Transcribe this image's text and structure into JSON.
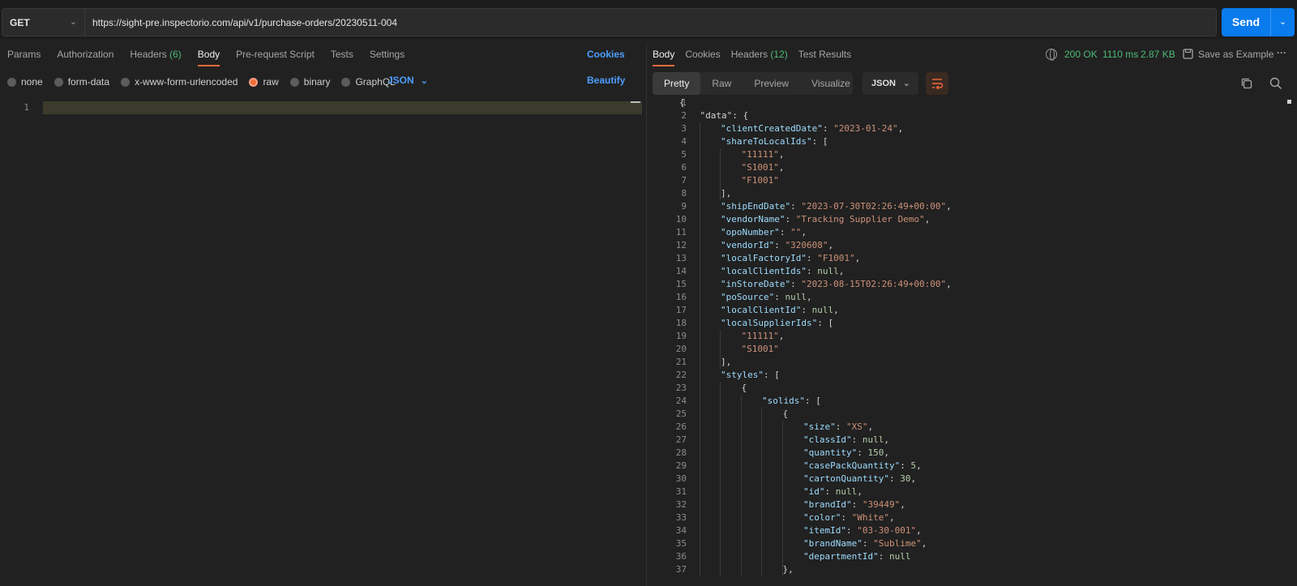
{
  "request": {
    "method": "GET",
    "url": "https://sight-pre.inspectorio.com/api/v1/purchase-orders/20230511-004",
    "send_label": "Send"
  },
  "request_tabs": [
    {
      "label": "Params"
    },
    {
      "label": "Authorization"
    },
    {
      "label": "Headers",
      "count": "(6)"
    },
    {
      "label": "Body",
      "active": true
    },
    {
      "label": "Pre-request Script"
    },
    {
      "label": "Tests"
    },
    {
      "label": "Settings"
    }
  ],
  "cookies_link": "Cookies",
  "beautify_link": "Beautify",
  "body_types": [
    {
      "label": "none"
    },
    {
      "label": "form-data"
    },
    {
      "label": "x-www-form-urlencoded"
    },
    {
      "label": "raw",
      "selected": true
    },
    {
      "label": "binary"
    },
    {
      "label": "GraphQL"
    }
  ],
  "body_format": "JSON",
  "editor": {
    "line_number": "1"
  },
  "response_tabs": [
    {
      "label": "Body",
      "active": true
    },
    {
      "label": "Cookies"
    },
    {
      "label": "Headers",
      "count": "(12)"
    },
    {
      "label": "Test Results"
    }
  ],
  "response_meta": {
    "status": "200 OK",
    "time": "1110 ms",
    "size": "2.87 KB",
    "save_label": "Save as Example",
    "more": "···"
  },
  "view_modes": [
    "Pretty",
    "Raw",
    "Preview",
    "Visualize"
  ],
  "response_format": "JSON",
  "response_lines": [
    [
      [
        "p",
        "{"
      ]
    ],
    [
      [
        "p",
        "\"data\": {"
      ]
    ],
    [
      [
        "k",
        "\"clientCreatedDate\""
      ],
      [
        "p",
        ": "
      ],
      [
        "s",
        "\"2023-01-24\""
      ],
      [
        "p",
        ","
      ]
    ],
    [
      [
        "k",
        "\"shareToLocalIds\""
      ],
      [
        "p",
        ": ["
      ]
    ],
    [
      [
        "s",
        "\"11111\""
      ],
      [
        "p",
        ","
      ]
    ],
    [
      [
        "s",
        "\"S1001\""
      ],
      [
        "p",
        ","
      ]
    ],
    [
      [
        "s",
        "\"F1001\""
      ]
    ],
    [
      [
        "p",
        "],"
      ]
    ],
    [
      [
        "k",
        "\"shipEndDate\""
      ],
      [
        "p",
        ": "
      ],
      [
        "s",
        "\"2023-07-30T02:26:49+00:00\""
      ],
      [
        "p",
        ","
      ]
    ],
    [
      [
        "k",
        "\"vendorName\""
      ],
      [
        "p",
        ": "
      ],
      [
        "s",
        "\"Tracking Supplier Demo\""
      ],
      [
        "p",
        ","
      ]
    ],
    [
      [
        "k",
        "\"opoNumber\""
      ],
      [
        "p",
        ": "
      ],
      [
        "s",
        "\"\""
      ],
      [
        "p",
        ","
      ]
    ],
    [
      [
        "k",
        "\"vendorId\""
      ],
      [
        "p",
        ": "
      ],
      [
        "s",
        "\"320608\""
      ],
      [
        "p",
        ","
      ]
    ],
    [
      [
        "k",
        "\"localFactoryId\""
      ],
      [
        "p",
        ": "
      ],
      [
        "s",
        "\"F1001\""
      ],
      [
        "p",
        ","
      ]
    ],
    [
      [
        "k",
        "\"localClientIds\""
      ],
      [
        "p",
        ": "
      ],
      [
        "n",
        "null"
      ],
      [
        "p",
        ","
      ]
    ],
    [
      [
        "k",
        "\"inStoreDate\""
      ],
      [
        "p",
        ": "
      ],
      [
        "s",
        "\"2023-08-15T02:26:49+00:00\""
      ],
      [
        "p",
        ","
      ]
    ],
    [
      [
        "k",
        "\"poSource\""
      ],
      [
        "p",
        ": "
      ],
      [
        "n",
        "null"
      ],
      [
        "p",
        ","
      ]
    ],
    [
      [
        "k",
        "\"localClientId\""
      ],
      [
        "p",
        ": "
      ],
      [
        "n",
        "null"
      ],
      [
        "p",
        ","
      ]
    ],
    [
      [
        "k",
        "\"localSupplierIds\""
      ],
      [
        "p",
        ": ["
      ]
    ],
    [
      [
        "s",
        "\"11111\""
      ],
      [
        "p",
        ","
      ]
    ],
    [
      [
        "s",
        "\"S1001\""
      ]
    ],
    [
      [
        "p",
        "],"
      ]
    ],
    [
      [
        "k",
        "\"styles\""
      ],
      [
        "p",
        ": ["
      ]
    ],
    [
      [
        "p",
        "{"
      ]
    ],
    [
      [
        "k",
        "\"solids\""
      ],
      [
        "p",
        ": ["
      ]
    ],
    [
      [
        "p",
        "{"
      ]
    ],
    [
      [
        "k",
        "\"size\""
      ],
      [
        "p",
        ": "
      ],
      [
        "s",
        "\"XS\""
      ],
      [
        "p",
        ","
      ]
    ],
    [
      [
        "k",
        "\"classId\""
      ],
      [
        "p",
        ": "
      ],
      [
        "n",
        "null"
      ],
      [
        "p",
        ","
      ]
    ],
    [
      [
        "k",
        "\"quantity\""
      ],
      [
        "p",
        ": "
      ],
      [
        "n",
        "150"
      ],
      [
        "p",
        ","
      ]
    ],
    [
      [
        "k",
        "\"casePackQuantity\""
      ],
      [
        "p",
        ": "
      ],
      [
        "n",
        "5"
      ],
      [
        "p",
        ","
      ]
    ],
    [
      [
        "k",
        "\"cartonQuantity\""
      ],
      [
        "p",
        ": "
      ],
      [
        "n",
        "30"
      ],
      [
        "p",
        ","
      ]
    ],
    [
      [
        "k",
        "\"id\""
      ],
      [
        "p",
        ": "
      ],
      [
        "n",
        "null"
      ],
      [
        "p",
        ","
      ]
    ],
    [
      [
        "k",
        "\"brandId\""
      ],
      [
        "p",
        ": "
      ],
      [
        "s",
        "\"39449\""
      ],
      [
        "p",
        ","
      ]
    ],
    [
      [
        "k",
        "\"color\""
      ],
      [
        "p",
        ": "
      ],
      [
        "s",
        "\"White\""
      ],
      [
        "p",
        ","
      ]
    ],
    [
      [
        "k",
        "\"itemId\""
      ],
      [
        "p",
        ": "
      ],
      [
        "s",
        "\"03-30-001\""
      ],
      [
        "p",
        ","
      ]
    ],
    [
      [
        "k",
        "\"brandName\""
      ],
      [
        "p",
        ": "
      ],
      [
        "s",
        "\"Sublime\""
      ],
      [
        "p",
        ","
      ]
    ],
    [
      [
        "k",
        "\"departmentId\""
      ],
      [
        "p",
        ": "
      ],
      [
        "n",
        "null"
      ]
    ],
    [
      [
        "p",
        "},"
      ]
    ]
  ],
  "colors": {
    "accent": "#f26b3a",
    "send": "#097bed",
    "link": "#4c9eff",
    "status": "#4dbb7a"
  }
}
